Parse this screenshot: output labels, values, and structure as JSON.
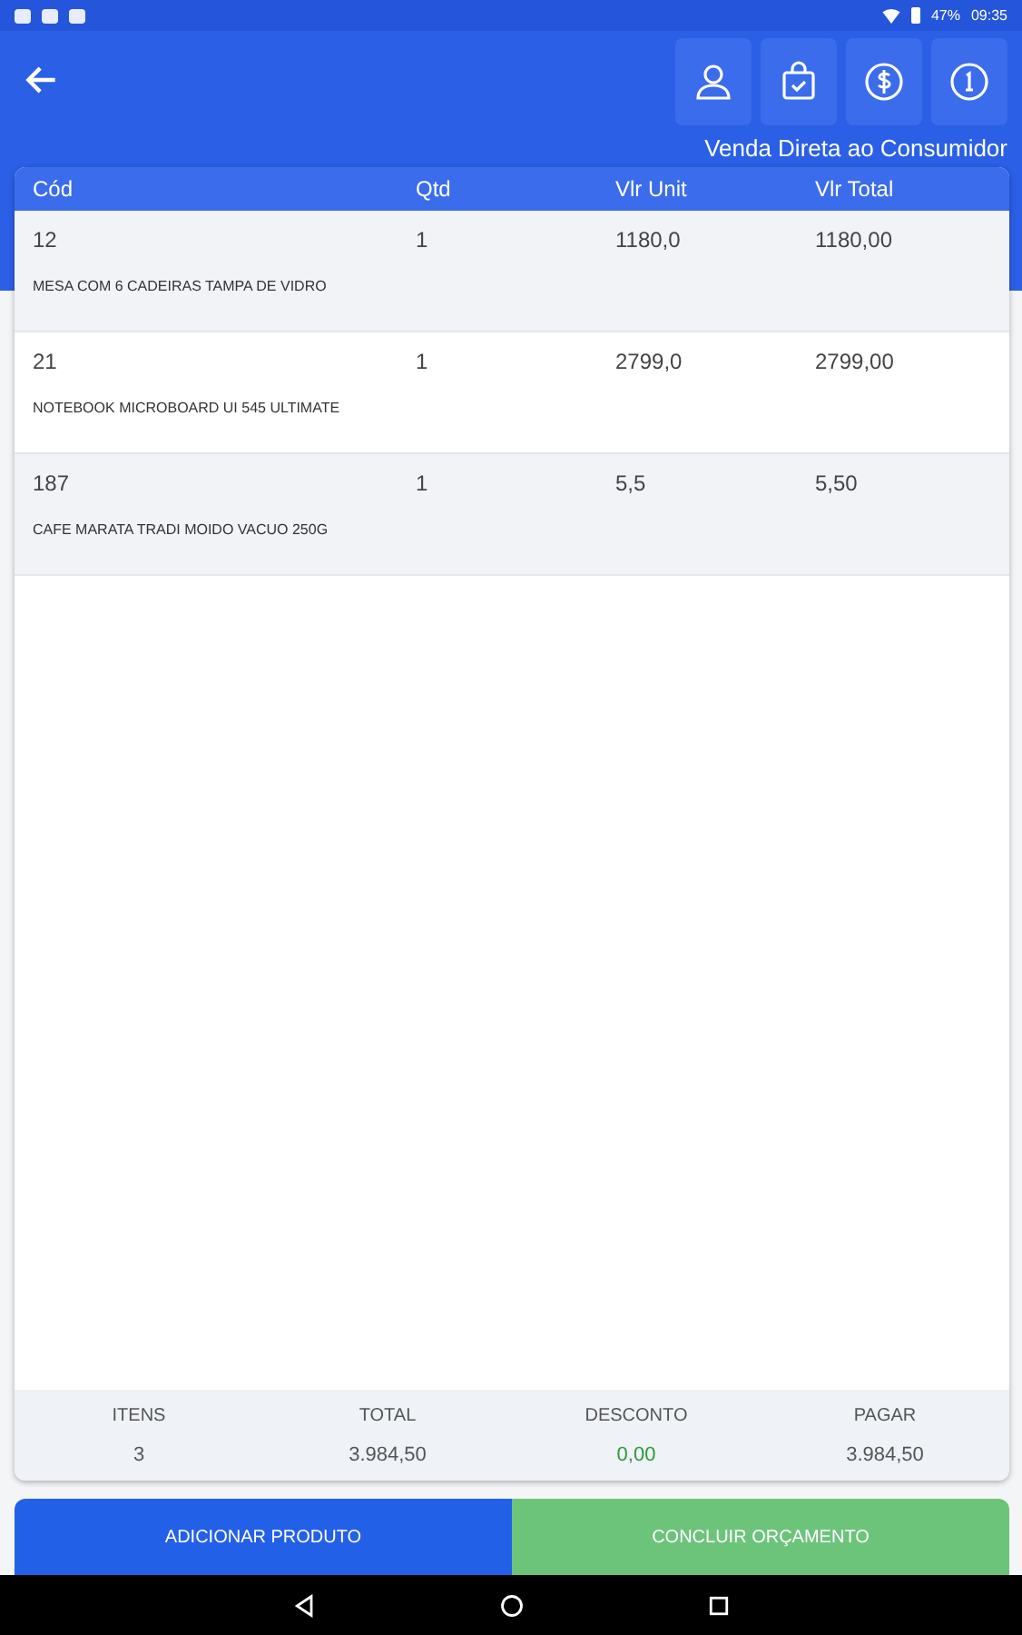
{
  "status_bar": {
    "battery": "47%",
    "time": "09:35"
  },
  "header": {
    "subtitle": "Venda Direta ao Consumidor"
  },
  "table": {
    "columns": [
      "Cód",
      "Qtd",
      "Vlr Unit",
      "Vlr Total"
    ],
    "rows": [
      {
        "code": "12",
        "qty": "1",
        "unit": "1180,0",
        "total": "1180,00",
        "description": "MESA COM 6 CADEIRAS TAMPA DE VIDRO"
      },
      {
        "code": "21",
        "qty": "1",
        "unit": "2799,0",
        "total": "2799,00",
        "description": "NOTEBOOK MICROBOARD UI 545 ULTIMATE"
      },
      {
        "code": "187",
        "qty": "1",
        "unit": "5,5",
        "total": "5,50",
        "description": "CAFE MARATA TRADI MOIDO VACUO 250G"
      }
    ]
  },
  "summary": [
    {
      "label": "ITENS",
      "value": "3",
      "kind": "plain"
    },
    {
      "label": "TOTAL",
      "value": "3.984,50",
      "kind": "plain"
    },
    {
      "label": "DESCONTO",
      "value": "0,00",
      "kind": "discount"
    },
    {
      "label": "PAGAR",
      "value": "3.984,50",
      "kind": "plain"
    }
  ],
  "buttons": [
    {
      "label": "ADICIONAR PRODUTO",
      "kind": "primary"
    },
    {
      "label": "CONCLUIR ORÇAMENTO",
      "kind": "success"
    }
  ]
}
